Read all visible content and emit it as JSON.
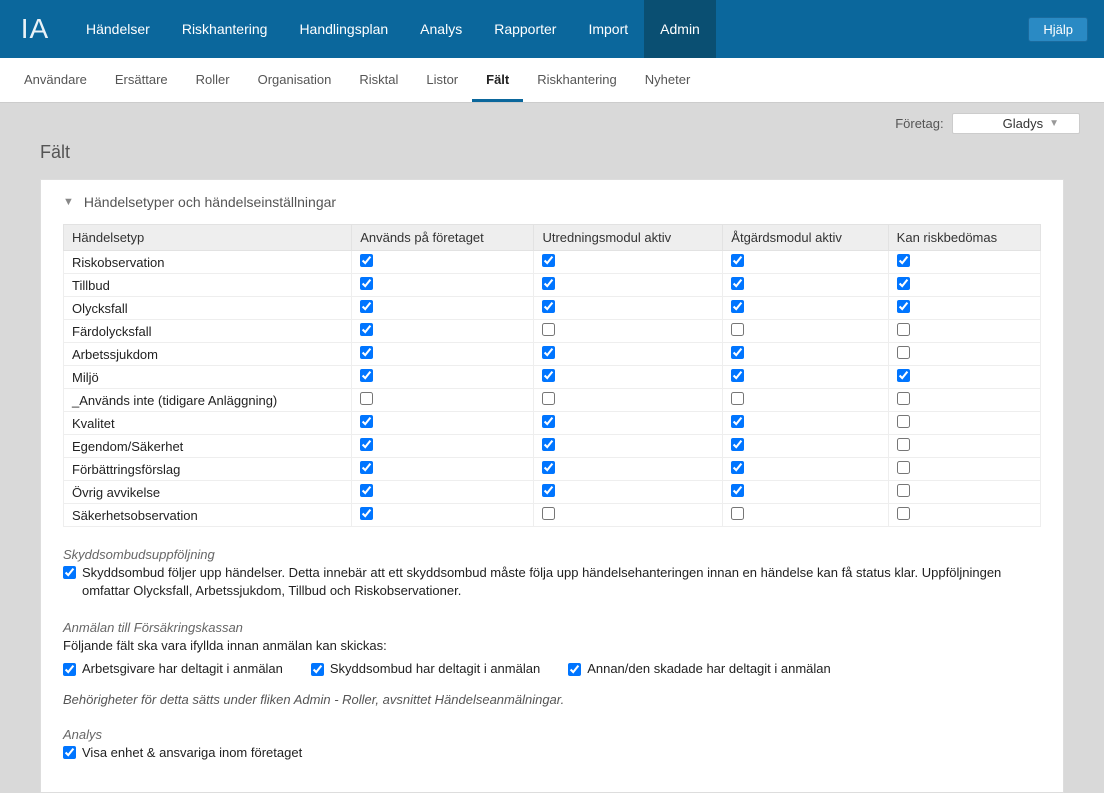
{
  "top_nav": {
    "logo": "IA",
    "items": [
      {
        "label": "Händelser"
      },
      {
        "label": "Riskhantering"
      },
      {
        "label": "Handlingsplan"
      },
      {
        "label": "Analys"
      },
      {
        "label": "Rapporter"
      },
      {
        "label": "Import"
      },
      {
        "label": "Admin",
        "active": true
      }
    ],
    "help": "Hjälp"
  },
  "sub_nav": {
    "items": [
      {
        "label": "Användare"
      },
      {
        "label": "Ersättare"
      },
      {
        "label": "Roller"
      },
      {
        "label": "Organisation"
      },
      {
        "label": "Risktal"
      },
      {
        "label": "Listor"
      },
      {
        "label": "Fält",
        "active": true
      },
      {
        "label": "Riskhantering"
      },
      {
        "label": "Nyheter"
      }
    ]
  },
  "company": {
    "label": "Företag:",
    "selected": "Gladys"
  },
  "page_title": "Fält",
  "panel": {
    "title": "Händelsetyper och händelseinställningar",
    "columns": [
      "Händelsetyp",
      "Används på företaget",
      "Utredningsmodul aktiv",
      "Åtgärdsmodul aktiv",
      "Kan riskbedömas"
    ],
    "rows": [
      {
        "name": "Riskobservation",
        "c": [
          true,
          true,
          true,
          true
        ]
      },
      {
        "name": "Tillbud",
        "c": [
          true,
          true,
          true,
          true
        ]
      },
      {
        "name": "Olycksfall",
        "c": [
          true,
          true,
          true,
          true
        ]
      },
      {
        "name": "Färdolycksfall",
        "c": [
          true,
          false,
          false,
          false
        ]
      },
      {
        "name": "Arbetssjukdom",
        "c": [
          true,
          true,
          true,
          false
        ]
      },
      {
        "name": "Miljö",
        "c": [
          true,
          true,
          true,
          true
        ]
      },
      {
        "name": "_Används inte (tidigare Anläggning)",
        "c": [
          false,
          false,
          false,
          false
        ]
      },
      {
        "name": "Kvalitet",
        "c": [
          true,
          true,
          true,
          false
        ]
      },
      {
        "name": "Egendom/Säkerhet",
        "c": [
          true,
          true,
          true,
          false
        ]
      },
      {
        "name": "Förbättringsförslag",
        "c": [
          true,
          true,
          true,
          false
        ]
      },
      {
        "name": "Övrig avvikelse",
        "c": [
          true,
          true,
          true,
          false
        ]
      },
      {
        "name": "Säkerhetsobservation",
        "c": [
          true,
          false,
          false,
          false
        ]
      }
    ]
  },
  "skydd": {
    "heading": "Skyddsombudsuppföljning",
    "checkbox_label": "Skyddsombud följer upp händelser. Detta innebär att ett skyddsombud måste följa upp händelsehanteringen innan en händelse kan få status klar. Uppföljningen omfattar Olycksfall, Arbetssjukdom, Tillbud och Riskobservationer.",
    "checked": true
  },
  "fk": {
    "heading": "Anmälan till Försäkringskassan",
    "intro": "Följande fält ska vara ifyllda innan anmälan kan skickas:",
    "options": [
      {
        "label": "Arbetsgivare har deltagit i anmälan",
        "checked": true
      },
      {
        "label": "Skyddsombud har deltagit i anmälan",
        "checked": true
      },
      {
        "label": "Annan/den skadade har deltagit i anmälan",
        "checked": true
      }
    ],
    "note": "Behörigheter för detta sätts under fliken Admin - Roller, avsnittet Händelseanmälningar."
  },
  "analys": {
    "heading": "Analys",
    "checkbox_label": "Visa enhet & ansvariga inom företaget",
    "checked": true
  }
}
